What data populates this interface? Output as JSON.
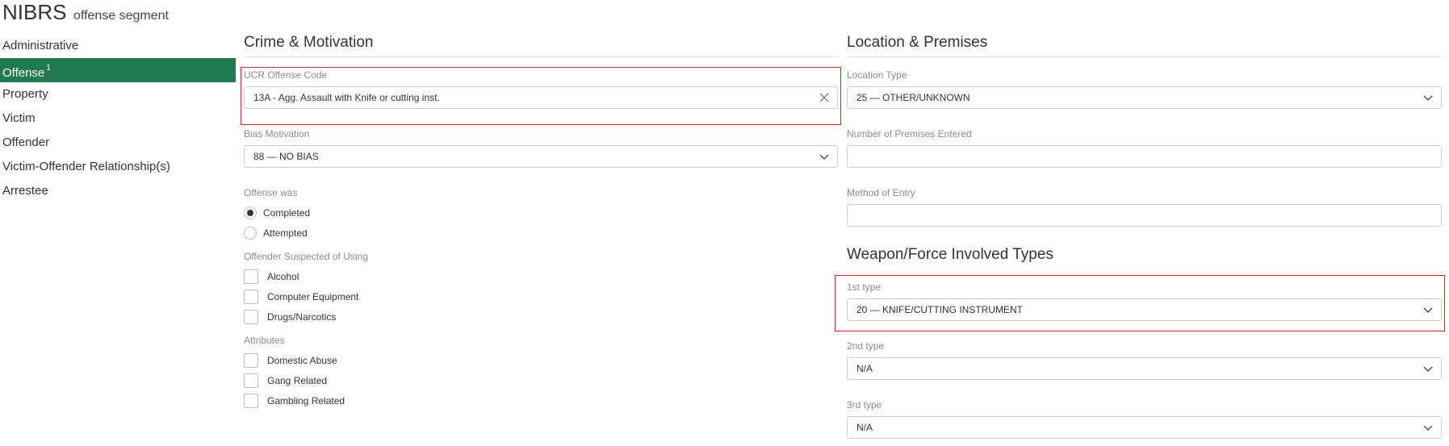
{
  "header": {
    "title": "NIBRS",
    "subtitle": "offense segment"
  },
  "sidebar": {
    "items": [
      {
        "label": "Administrative",
        "badge": ""
      },
      {
        "label": "Offense",
        "badge": "1"
      },
      {
        "label": "Property",
        "badge": ""
      },
      {
        "label": "Victim",
        "badge": ""
      },
      {
        "label": "Offender",
        "badge": ""
      },
      {
        "label": "Victim-Offender Relationship(s)",
        "badge": ""
      },
      {
        "label": "Arrestee",
        "badge": ""
      }
    ],
    "active_index": 1,
    "active_color": "#1f7a4d"
  },
  "crime": {
    "section_title": "Crime & Motivation",
    "ucr_label": "UCR Offense Code",
    "ucr_value": "13A - Agg. Assault with Knife or cutting inst.",
    "bias_label": "Bias Motivation",
    "bias_value": "88 — NO BIAS",
    "offense_was_label": "Offense was",
    "offense_was_options": [
      "Completed",
      "Attempted"
    ],
    "offense_was_selected": "Completed",
    "suspected_label": "Offender Suspected of Using",
    "suspected_options": [
      "Alcohol",
      "Computer Equipment",
      "Drugs/Narcotics"
    ],
    "attributes_label": "Attributes",
    "attributes_options": [
      "Domestic Abuse",
      "Gang Related",
      "Gambling Related"
    ]
  },
  "location": {
    "section_title": "Location & Premises",
    "type_label": "Location Type",
    "type_value": "25 — OTHER/UNKNOWN",
    "premises_label": "Number of Premises Entered",
    "premises_value": "",
    "entry_label": "Method of Entry",
    "entry_value": ""
  },
  "weapon": {
    "section_title": "Weapon/Force Involved Types",
    "first_label": "1st type",
    "first_value": "20 — KNIFE/CUTTING INSTRUMENT",
    "second_label": "2nd type",
    "second_value": "N/A",
    "third_label": "3rd type",
    "third_value": "N/A"
  },
  "colors": {
    "highlight_border": "#cc2b2b",
    "accent": "#1f7a4d"
  },
  "icons": {
    "dropdown": "chevron-down-icon",
    "clear": "close-icon"
  }
}
